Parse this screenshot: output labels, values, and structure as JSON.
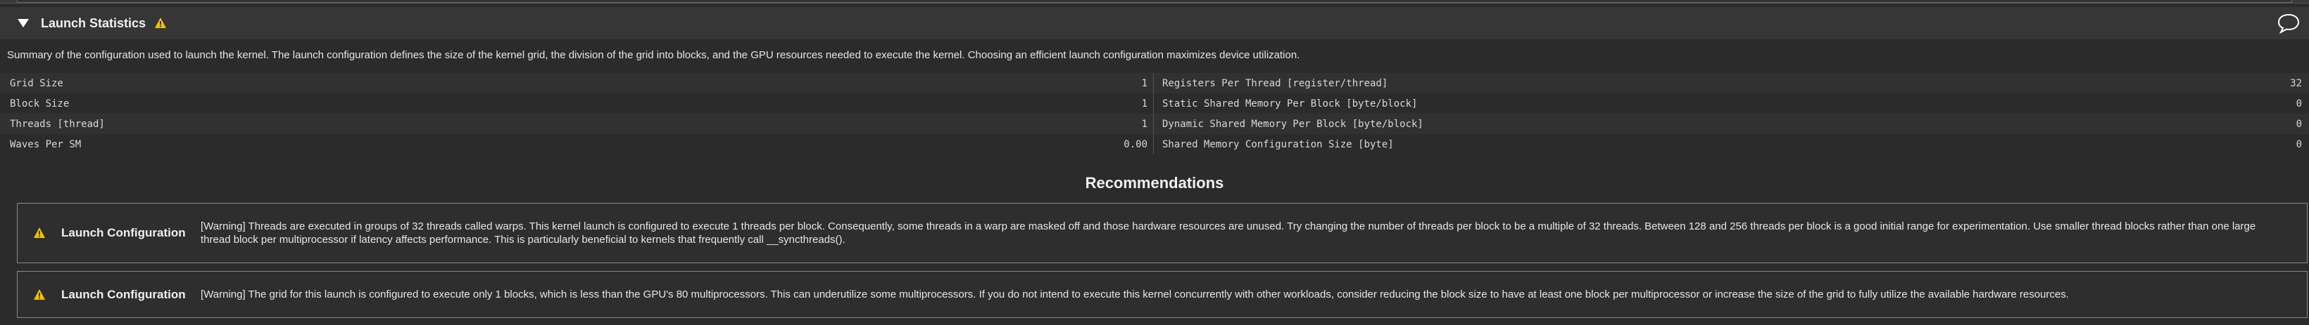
{
  "section": {
    "title": "Launch Statistics",
    "description": "Summary of the configuration used to launch the kernel. The launch configuration defines the size of the kernel grid, the division of the grid into blocks, and the GPU resources needed to execute the kernel. Choosing an efficient launch configuration maximizes device utilization."
  },
  "stats": {
    "left": [
      {
        "label": "Grid Size",
        "value": "1"
      },
      {
        "label": "Block Size",
        "value": "1"
      },
      {
        "label": "Threads [thread]",
        "value": "1"
      },
      {
        "label": "Waves Per SM",
        "value": "0.00"
      }
    ],
    "right": [
      {
        "label": "Registers Per Thread [register/thread]",
        "value": "32"
      },
      {
        "label": "Static Shared Memory Per Block [byte/block]",
        "value": "0"
      },
      {
        "label": "Dynamic Shared Memory Per Block [byte/block]",
        "value": "0"
      },
      {
        "label": "Shared Memory Configuration Size [byte]",
        "value": "0"
      }
    ]
  },
  "recommendations": {
    "title": "Recommendations",
    "items": [
      {
        "name": "Launch Configuration",
        "text": "[Warning] Threads are executed in groups of 32 threads called warps. This kernel launch is configured to execute 1 threads per block. Consequently, some threads in a warp are masked off and those hardware resources are unused. Try changing the number of threads per block to be a multiple of 32 threads. Between 128 and 256 threads per block is a good initial range for experimentation. Use smaller thread blocks rather than one large thread block per multiprocessor if latency affects performance. This is particularly beneficial to kernels that frequently call __syncthreads()."
      },
      {
        "name": "Launch Configuration",
        "text": "[Warning] The grid for this launch is configured to execute only 1 blocks, which is less than the GPU's 80 multiprocessors. This can underutilize some multiprocessors. If you do not intend to execute this kernel concurrently with other workloads, consider reducing the block size to have at least one block per multiprocessor or increase the size of the grid to fully utilize the available hardware resources."
      }
    ]
  },
  "colors": {
    "warning": "#f2c200",
    "background": "#2b2b2b",
    "header": "#363636"
  }
}
